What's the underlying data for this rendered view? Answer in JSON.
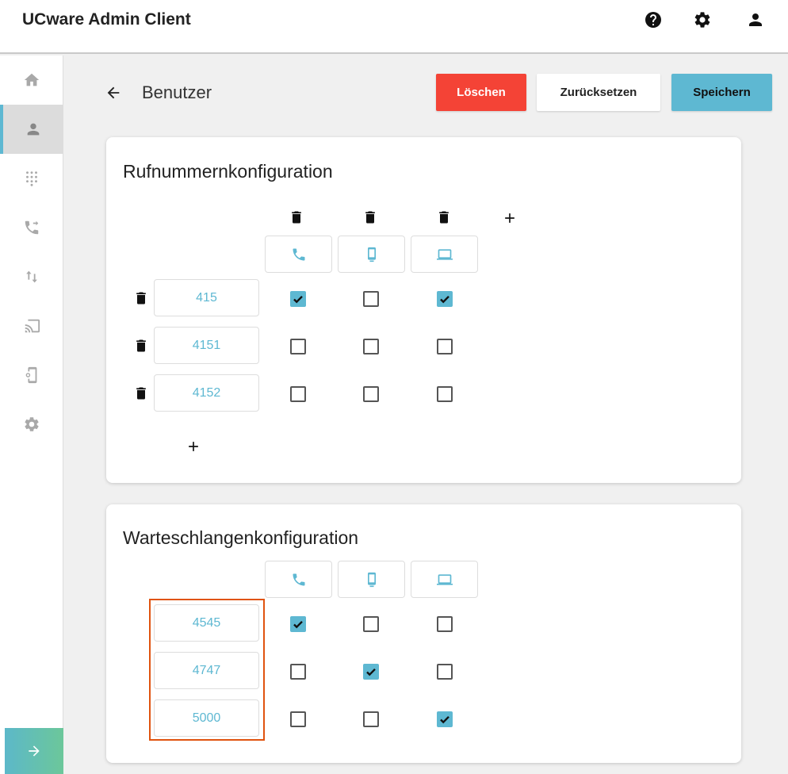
{
  "app": {
    "title": "UCware Admin Client"
  },
  "topbar": {
    "icons": [
      "help-icon",
      "gear-icon",
      "account-icon"
    ]
  },
  "sidebar": {
    "items": [
      {
        "icon": "home-icon",
        "active": false
      },
      {
        "icon": "user-icon",
        "active": true
      },
      {
        "icon": "dialpad-icon",
        "active": false
      },
      {
        "icon": "call-forward-icon",
        "active": false
      },
      {
        "icon": "transfer-arrows-icon",
        "active": false
      },
      {
        "icon": "cast-icon",
        "active": false
      },
      {
        "icon": "device-settings-icon",
        "active": false
      },
      {
        "icon": "gear-icon",
        "active": false
      }
    ],
    "expand_icon": "arrow-right-icon"
  },
  "header": {
    "title": "Benutzer",
    "buttons": {
      "delete": "Löschen",
      "reset": "Zurücksetzen",
      "save": "Speichern"
    }
  },
  "colors": {
    "accent": "#5eb8d2",
    "danger": "#f44336",
    "highlight": "#e0530f"
  },
  "number_config": {
    "title": "Rufnummernkonfiguration",
    "devices": [
      "phone-icon",
      "smartphone-icon",
      "laptop-icon"
    ],
    "rows": [
      {
        "number": "415",
        "checks": [
          true,
          false,
          true
        ]
      },
      {
        "number": "4151",
        "checks": [
          false,
          false,
          false
        ]
      },
      {
        "number": "4152",
        "checks": [
          false,
          false,
          false
        ]
      }
    ]
  },
  "queue_config": {
    "title": "Warteschlangenkonfiguration",
    "devices": [
      "phone-icon",
      "smartphone-icon",
      "laptop-icon"
    ],
    "rows": [
      {
        "number": "4545",
        "checks": [
          true,
          false,
          false
        ]
      },
      {
        "number": "4747",
        "checks": [
          false,
          true,
          false
        ]
      },
      {
        "number": "5000",
        "checks": [
          false,
          false,
          true
        ]
      }
    ]
  }
}
